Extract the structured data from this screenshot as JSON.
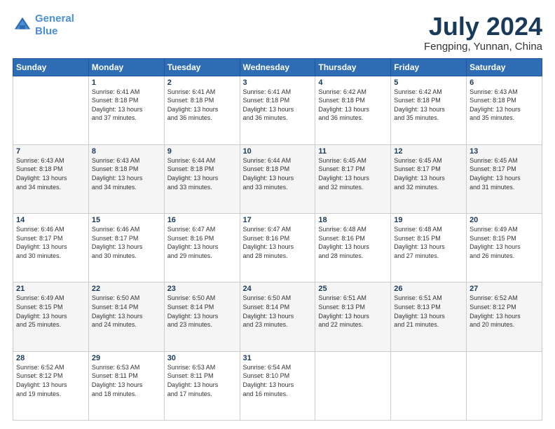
{
  "header": {
    "logo_line1": "General",
    "logo_line2": "Blue",
    "title": "July 2024",
    "subtitle": "Fengping, Yunnan, China"
  },
  "weekdays": [
    "Sunday",
    "Monday",
    "Tuesday",
    "Wednesday",
    "Thursday",
    "Friday",
    "Saturday"
  ],
  "weeks": [
    [
      {
        "day": "",
        "info": ""
      },
      {
        "day": "1",
        "info": "Sunrise: 6:41 AM\nSunset: 8:18 PM\nDaylight: 13 hours\nand 37 minutes."
      },
      {
        "day": "2",
        "info": "Sunrise: 6:41 AM\nSunset: 8:18 PM\nDaylight: 13 hours\nand 36 minutes."
      },
      {
        "day": "3",
        "info": "Sunrise: 6:41 AM\nSunset: 8:18 PM\nDaylight: 13 hours\nand 36 minutes."
      },
      {
        "day": "4",
        "info": "Sunrise: 6:42 AM\nSunset: 8:18 PM\nDaylight: 13 hours\nand 36 minutes."
      },
      {
        "day": "5",
        "info": "Sunrise: 6:42 AM\nSunset: 8:18 PM\nDaylight: 13 hours\nand 35 minutes."
      },
      {
        "day": "6",
        "info": "Sunrise: 6:43 AM\nSunset: 8:18 PM\nDaylight: 13 hours\nand 35 minutes."
      }
    ],
    [
      {
        "day": "7",
        "info": "Sunrise: 6:43 AM\nSunset: 8:18 PM\nDaylight: 13 hours\nand 34 minutes."
      },
      {
        "day": "8",
        "info": "Sunrise: 6:43 AM\nSunset: 8:18 PM\nDaylight: 13 hours\nand 34 minutes."
      },
      {
        "day": "9",
        "info": "Sunrise: 6:44 AM\nSunset: 8:18 PM\nDaylight: 13 hours\nand 33 minutes."
      },
      {
        "day": "10",
        "info": "Sunrise: 6:44 AM\nSunset: 8:18 PM\nDaylight: 13 hours\nand 33 minutes."
      },
      {
        "day": "11",
        "info": "Sunrise: 6:45 AM\nSunset: 8:17 PM\nDaylight: 13 hours\nand 32 minutes."
      },
      {
        "day": "12",
        "info": "Sunrise: 6:45 AM\nSunset: 8:17 PM\nDaylight: 13 hours\nand 32 minutes."
      },
      {
        "day": "13",
        "info": "Sunrise: 6:45 AM\nSunset: 8:17 PM\nDaylight: 13 hours\nand 31 minutes."
      }
    ],
    [
      {
        "day": "14",
        "info": "Sunrise: 6:46 AM\nSunset: 8:17 PM\nDaylight: 13 hours\nand 30 minutes."
      },
      {
        "day": "15",
        "info": "Sunrise: 6:46 AM\nSunset: 8:17 PM\nDaylight: 13 hours\nand 30 minutes."
      },
      {
        "day": "16",
        "info": "Sunrise: 6:47 AM\nSunset: 8:16 PM\nDaylight: 13 hours\nand 29 minutes."
      },
      {
        "day": "17",
        "info": "Sunrise: 6:47 AM\nSunset: 8:16 PM\nDaylight: 13 hours\nand 28 minutes."
      },
      {
        "day": "18",
        "info": "Sunrise: 6:48 AM\nSunset: 8:16 PM\nDaylight: 13 hours\nand 28 minutes."
      },
      {
        "day": "19",
        "info": "Sunrise: 6:48 AM\nSunset: 8:15 PM\nDaylight: 13 hours\nand 27 minutes."
      },
      {
        "day": "20",
        "info": "Sunrise: 6:49 AM\nSunset: 8:15 PM\nDaylight: 13 hours\nand 26 minutes."
      }
    ],
    [
      {
        "day": "21",
        "info": "Sunrise: 6:49 AM\nSunset: 8:15 PM\nDaylight: 13 hours\nand 25 minutes."
      },
      {
        "day": "22",
        "info": "Sunrise: 6:50 AM\nSunset: 8:14 PM\nDaylight: 13 hours\nand 24 minutes."
      },
      {
        "day": "23",
        "info": "Sunrise: 6:50 AM\nSunset: 8:14 PM\nDaylight: 13 hours\nand 23 minutes."
      },
      {
        "day": "24",
        "info": "Sunrise: 6:50 AM\nSunset: 8:14 PM\nDaylight: 13 hours\nand 23 minutes."
      },
      {
        "day": "25",
        "info": "Sunrise: 6:51 AM\nSunset: 8:13 PM\nDaylight: 13 hours\nand 22 minutes."
      },
      {
        "day": "26",
        "info": "Sunrise: 6:51 AM\nSunset: 8:13 PM\nDaylight: 13 hours\nand 21 minutes."
      },
      {
        "day": "27",
        "info": "Sunrise: 6:52 AM\nSunset: 8:12 PM\nDaylight: 13 hours\nand 20 minutes."
      }
    ],
    [
      {
        "day": "28",
        "info": "Sunrise: 6:52 AM\nSunset: 8:12 PM\nDaylight: 13 hours\nand 19 minutes."
      },
      {
        "day": "29",
        "info": "Sunrise: 6:53 AM\nSunset: 8:11 PM\nDaylight: 13 hours\nand 18 minutes."
      },
      {
        "day": "30",
        "info": "Sunrise: 6:53 AM\nSunset: 8:11 PM\nDaylight: 13 hours\nand 17 minutes."
      },
      {
        "day": "31",
        "info": "Sunrise: 6:54 AM\nSunset: 8:10 PM\nDaylight: 13 hours\nand 16 minutes."
      },
      {
        "day": "",
        "info": ""
      },
      {
        "day": "",
        "info": ""
      },
      {
        "day": "",
        "info": ""
      }
    ]
  ]
}
